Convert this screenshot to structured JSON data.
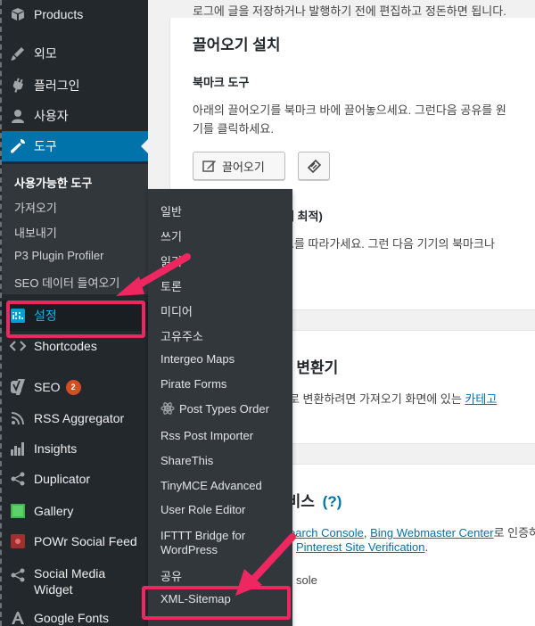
{
  "sidebar": {
    "items": [
      {
        "label": "Products",
        "icon": "products-icon"
      },
      {
        "label": "외모",
        "icon": "appearance-icon"
      },
      {
        "label": "플러그인",
        "icon": "plugins-icon"
      },
      {
        "label": "사용자",
        "icon": "users-icon"
      },
      {
        "label": "도구",
        "icon": "tools-icon"
      },
      {
        "label": "설정",
        "icon": "settings-icon"
      },
      {
        "label": "Shortcodes",
        "icon": "shortcodes-icon"
      },
      {
        "label": "SEO",
        "icon": "seo-icon",
        "badge": "2"
      },
      {
        "label": "RSS Aggregator",
        "icon": "rss-icon"
      },
      {
        "label": "Insights",
        "icon": "insights-icon"
      },
      {
        "label": "Duplicator",
        "icon": "duplicator-icon"
      },
      {
        "label": "Gallery",
        "icon": "gallery-icon"
      },
      {
        "label": "POWr Social Feed",
        "icon": "powr-icon"
      },
      {
        "label": "Social Media Widget",
        "icon": "share-icon"
      },
      {
        "label": "Google Fonts",
        "icon": "fonts-icon"
      }
    ],
    "tools_submenu": [
      "사용가능한 도구",
      "가져오기",
      "내보내기",
      "P3 Plugin Profiler",
      "SEO 데이터 들여오기"
    ]
  },
  "flyout": {
    "items": [
      "일반",
      "쓰기",
      "읽기",
      "토론",
      "미디어",
      "고유주소",
      "Intergeo Maps",
      "Pirate Forms",
      "Post Types Order",
      "Rss Post Importer",
      "ShareThis",
      "TinyMCE Advanced",
      "User Role Editor",
      "IFTTT Bridge for",
      "WordPress",
      "공유",
      "XML-Sitemap"
    ]
  },
  "main": {
    "intro_text": "로그에 글을 저장하거나 발행하기 전에 편집하고 정돈하면 됩니다.",
    "pressthis_title": "끌어오기 설치",
    "bookmarklet_heading": "북마크 도구",
    "bookmarklet_desc1": "아래의 끌어오기를 북마크 바에 끌어놓으세요. 그런다음 공유를 원",
    "bookmarklet_desc2": "기를 클릭하세요.",
    "pressthis_button": "끌어오기",
    "mobile_heading": "일에 최적)",
    "mobile_desc": "링크를 따라가세요. 그런 다음 기기의 북마크나",
    "converter_title": "고 변환기",
    "converter_desc_pre": "서로 변환하려면 가져오기 화면에 있는 ",
    "converter_link": "카테고",
    "verify_title": "서비스",
    "verify_help": "(?)",
    "verify_link1": "earch Console",
    "verify_sep": ", ",
    "verify_link2": "Bing Webmaster Center",
    "verify_after": "로 인증하",
    "verify_link3": "Pinterest Site Verification",
    "verify_period": ".",
    "console_text": "sole"
  },
  "colors": {
    "sidebar_bg": "#23282d",
    "submenu_bg": "#32373c",
    "accent": "#0073aa",
    "highlight": "#ee2761",
    "badge": "#d54e21"
  }
}
